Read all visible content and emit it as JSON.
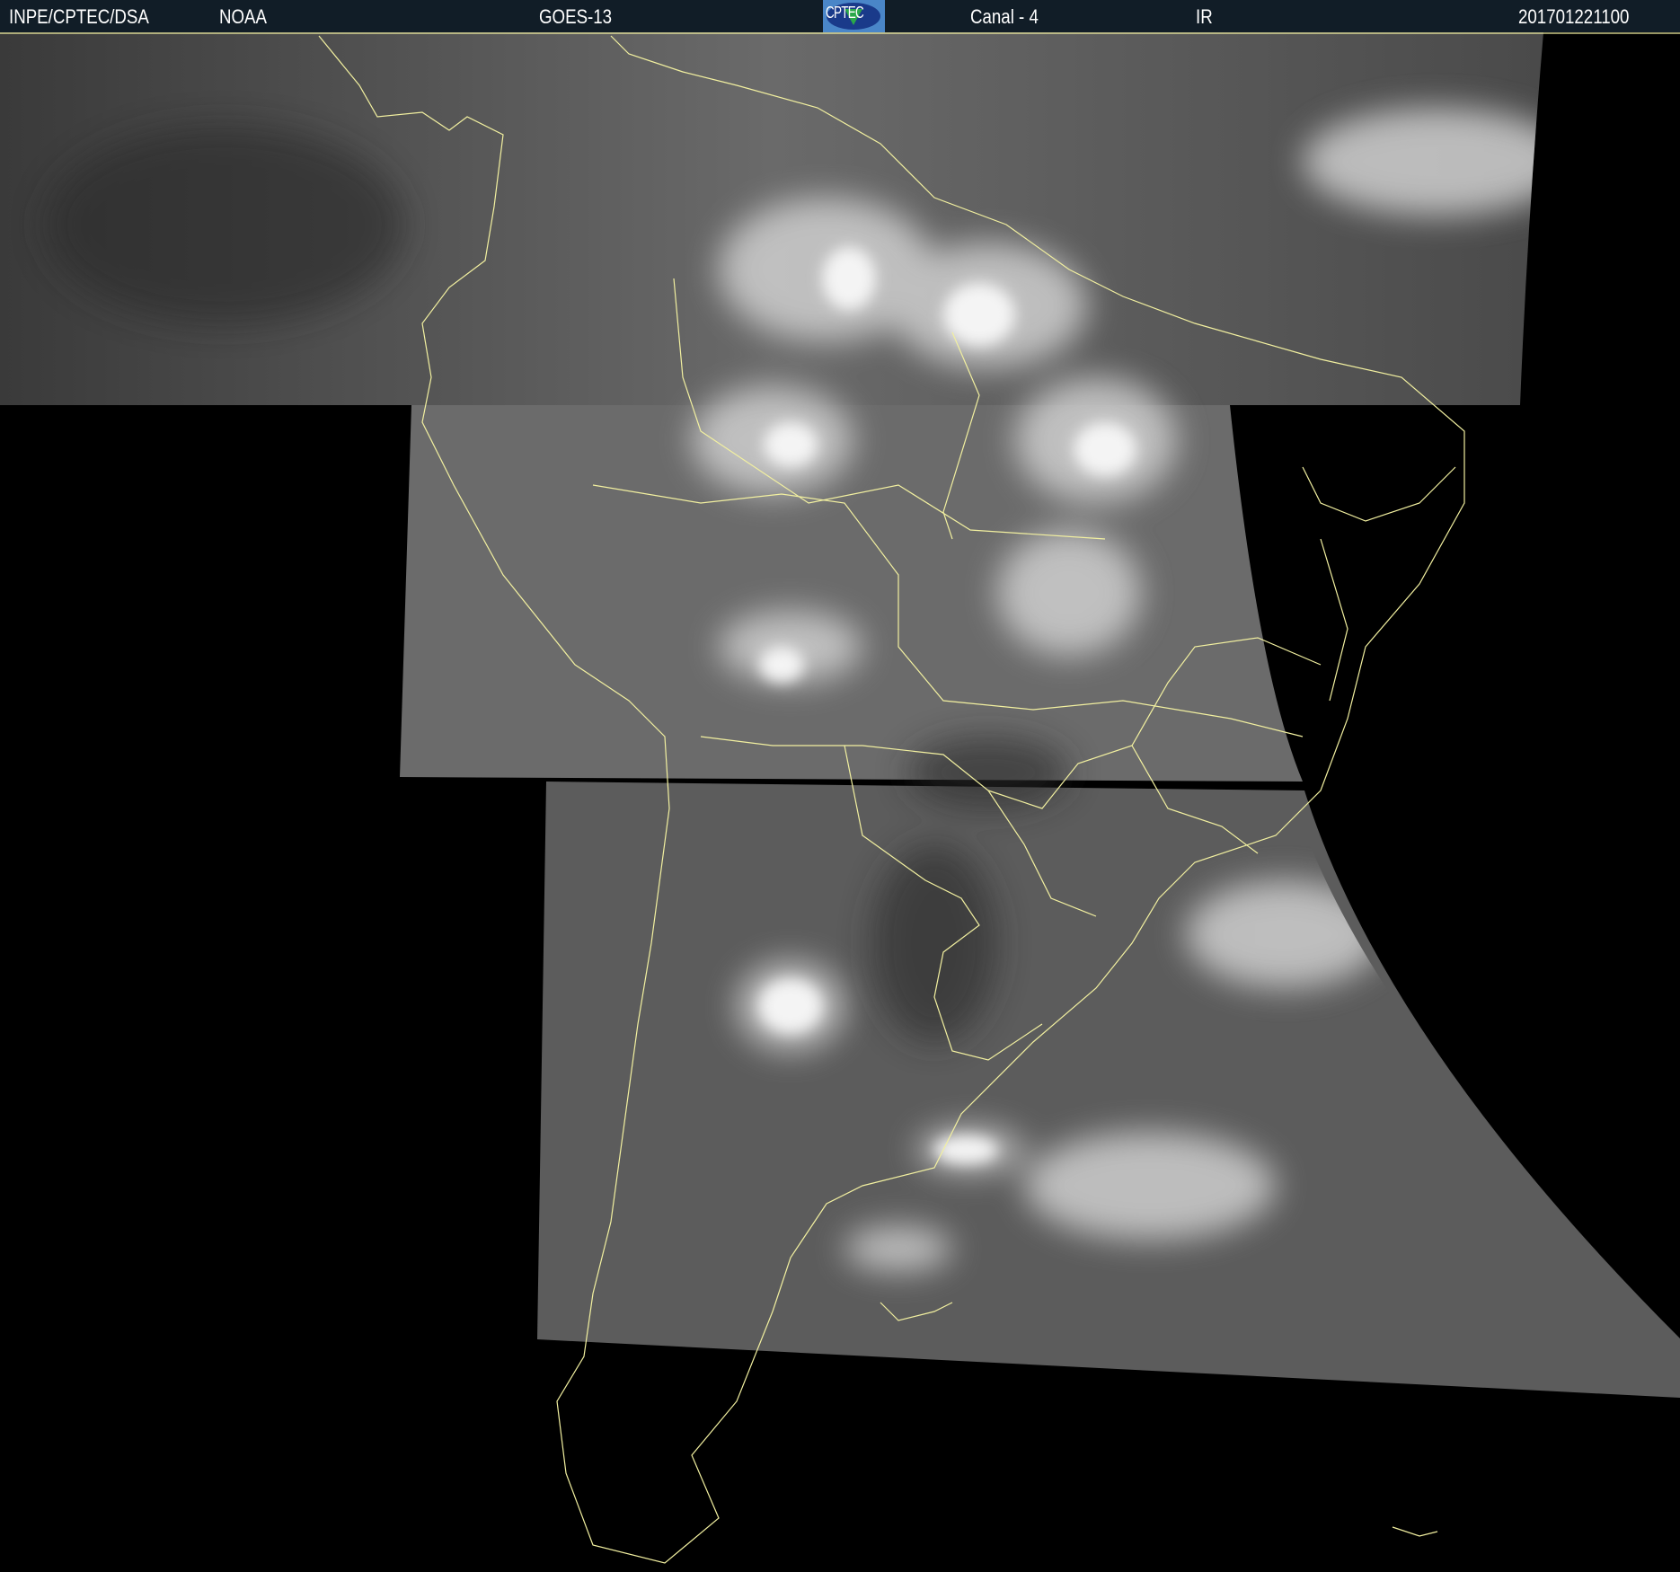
{
  "header": {
    "org": "INPE/CPTEC/DSA",
    "agency": "NOAA",
    "satellite": "GOES-13",
    "logo_text": "CPTEC",
    "channel": "Canal - 4",
    "band": "IR",
    "timestamp": "201701221100"
  },
  "colors": {
    "header_bg": "#111d27",
    "coastline": "#f2f0a0",
    "cloud": "#e8e8e8",
    "surface": "#5a5a5a"
  }
}
